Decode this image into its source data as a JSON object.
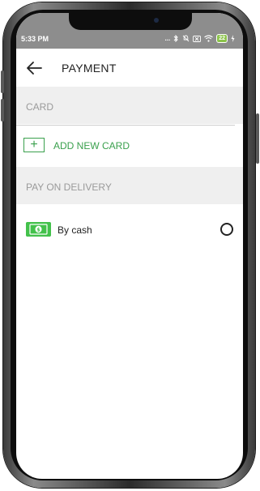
{
  "status_bar": {
    "time": "5:33 PM",
    "dots": "...",
    "battery": "22",
    "icons": [
      "bluetooth-icon",
      "mute-icon",
      "sim-off-icon",
      "wifi-icon",
      "battery-icon",
      "charging-icon"
    ]
  },
  "header": {
    "title": "PAYMENT",
    "back_icon": "arrow-left-icon"
  },
  "sections": {
    "card": {
      "title": "CARD",
      "add_label": "ADD NEW CARD",
      "add_icon": "plus-icon"
    },
    "pay_on_delivery": {
      "title": "PAY ON DELIVERY",
      "options": [
        {
          "label": "By cash",
          "icon": "cash-icon",
          "selected": false
        }
      ]
    }
  },
  "colors": {
    "accent": "#3aa04d",
    "cash": "#43c14b",
    "section_bg": "#efefef",
    "status_bar_bg": "#8d8d8d"
  }
}
